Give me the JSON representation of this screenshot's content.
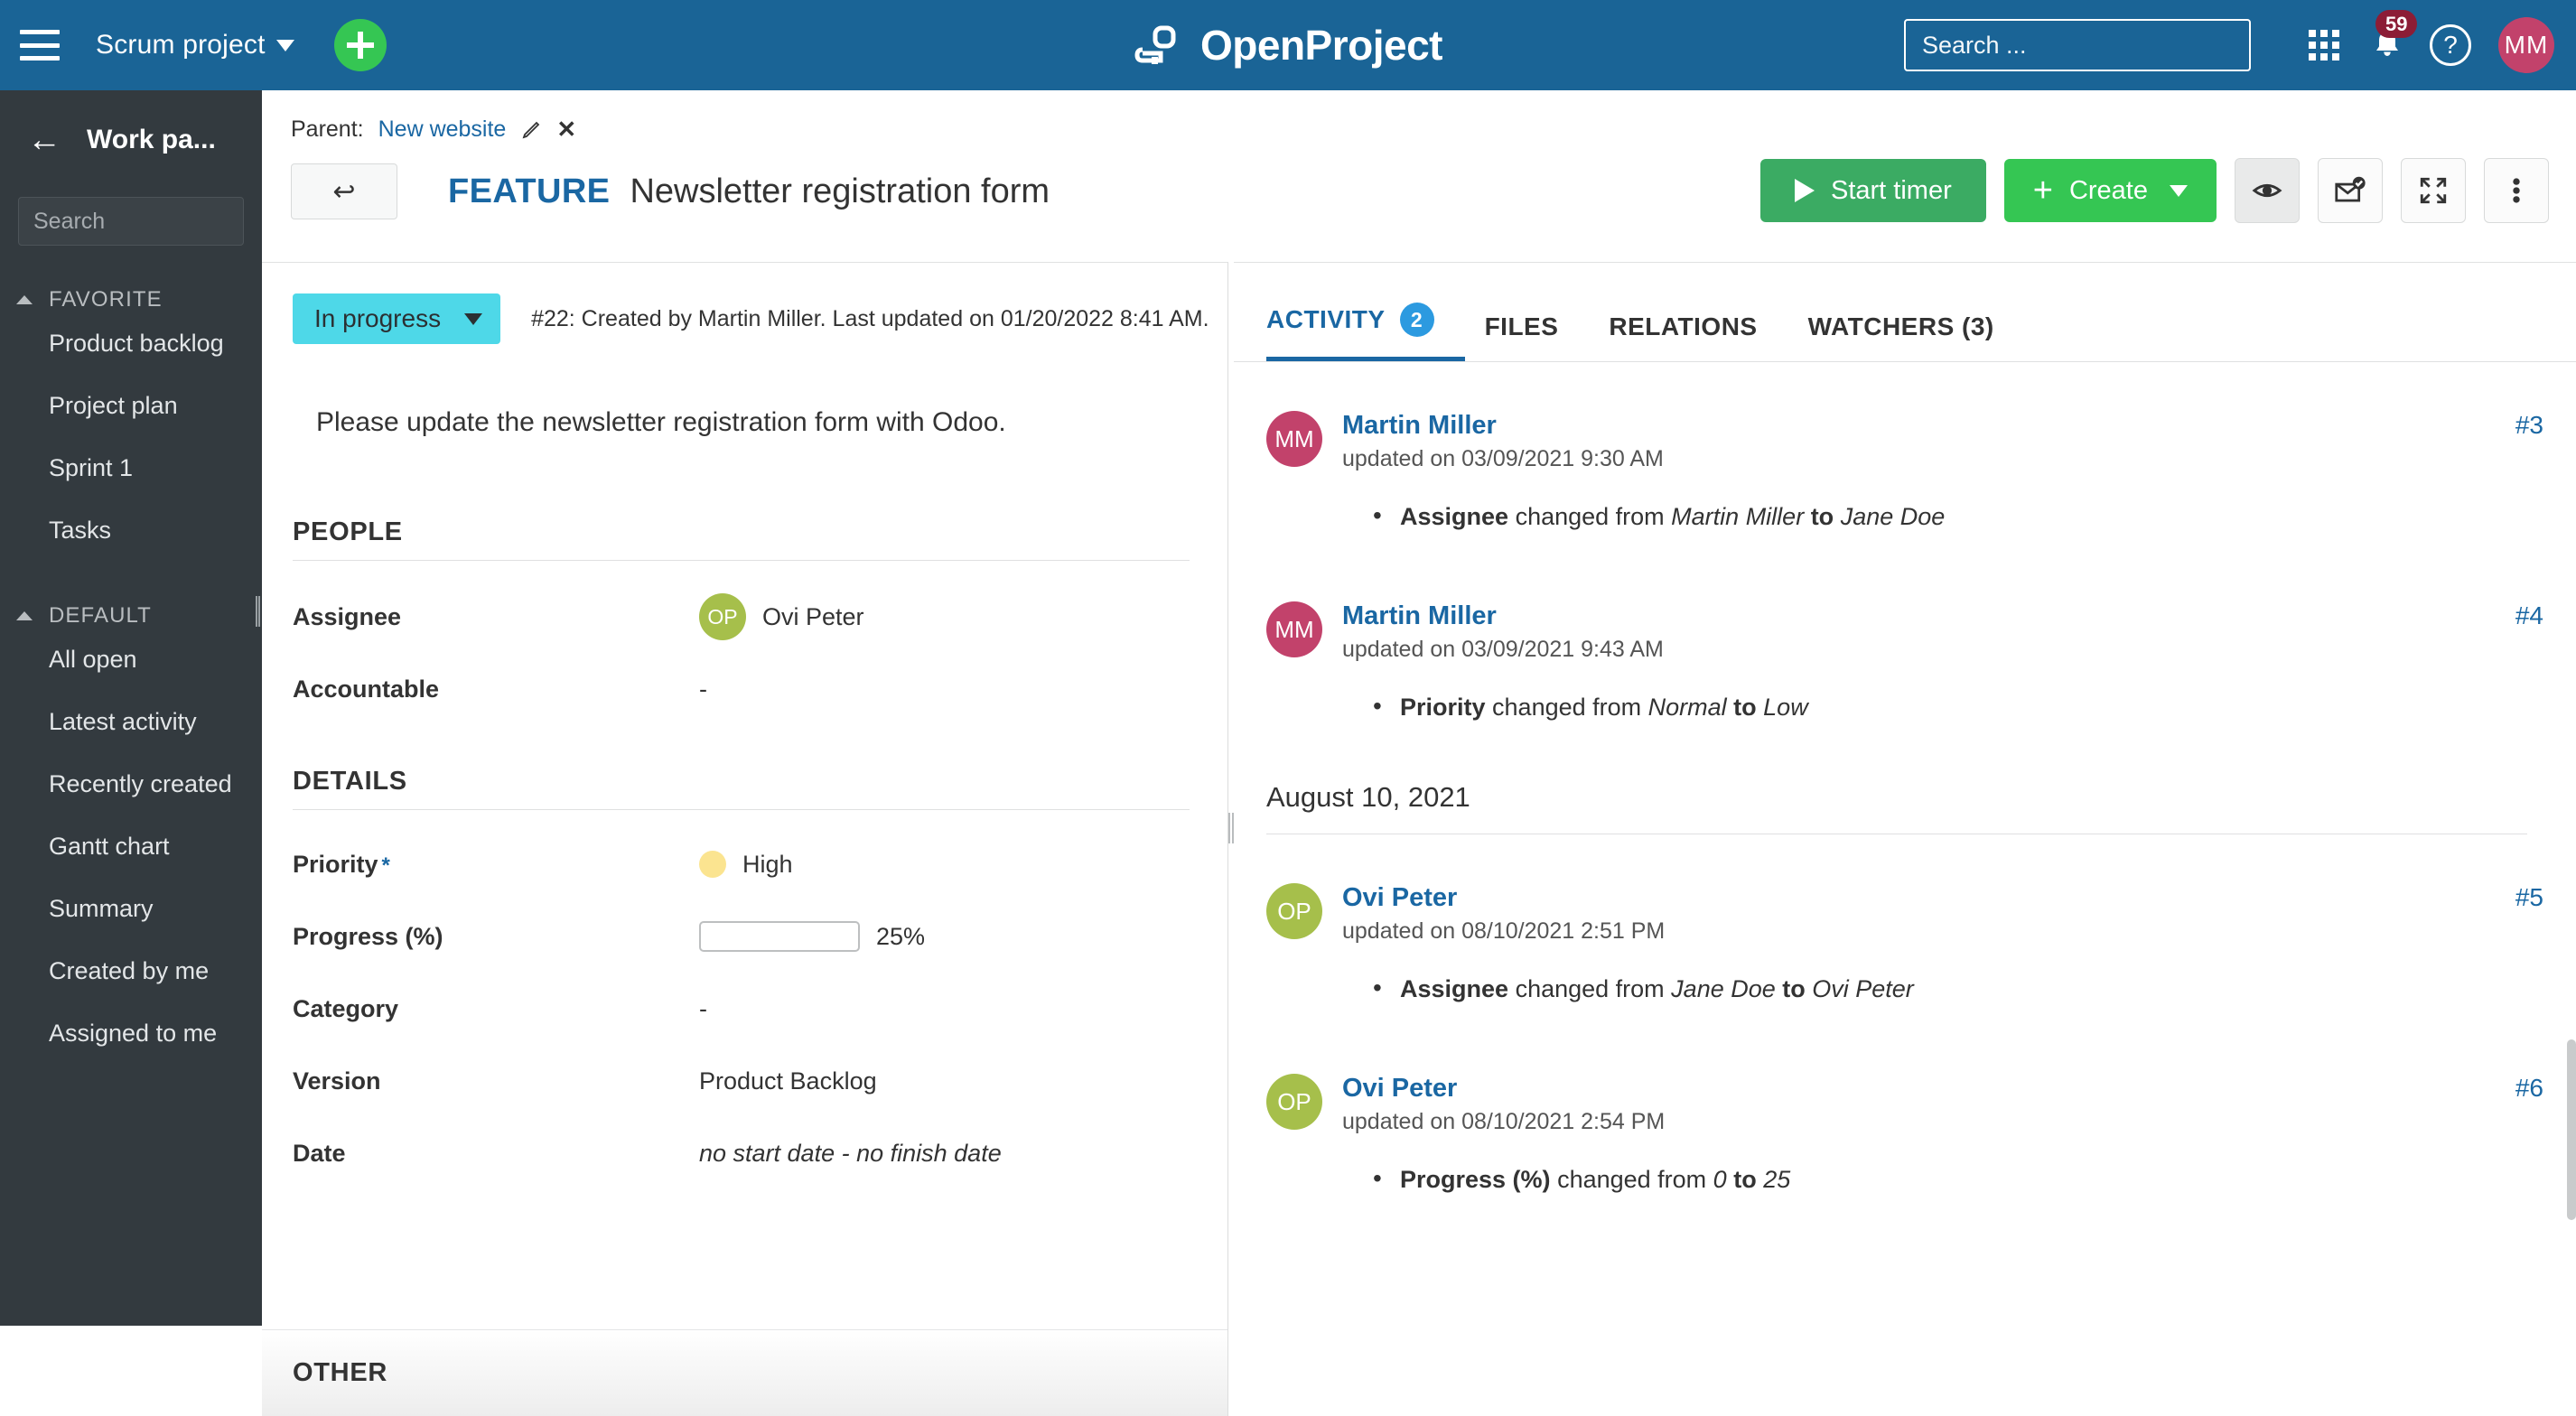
{
  "header": {
    "menu_icon": "hamburger-icon",
    "project_name": "Scrum project",
    "add_label": "+",
    "brand": "OpenProject",
    "search_placeholder": "Search ...",
    "search_value": "",
    "modules_icon": "grid-icon",
    "notification_count": "59",
    "help_label": "?",
    "avatar_initials": "MM"
  },
  "sidebar": {
    "title": "Work pa...",
    "back_icon": "arrow-left-icon",
    "search_placeholder": "Search",
    "search_value": "",
    "groups": [
      {
        "label": "FAVORITE",
        "items": [
          "Product backlog",
          "Project plan",
          "Sprint 1",
          "Tasks"
        ]
      },
      {
        "label": "DEFAULT",
        "items": [
          "All open",
          "Latest activity",
          "Recently created",
          "Gantt chart",
          "Summary",
          "Created by me",
          "Assigned to me"
        ]
      }
    ]
  },
  "work_package": {
    "parent_prefix": "Parent:",
    "parent_name": "New website",
    "back_icon": "back-arrow-icon",
    "type": "FEATURE",
    "subject": "Newsletter registration form",
    "status": "In progress",
    "status_color": "#4ed8e8",
    "meta": "#22: Created by Martin Miller. Last updated on 01/20/2022 8:41 AM.",
    "description": "Please update the newsletter registration form with Odoo."
  },
  "toolbar": {
    "start_timer_label": "Start timer",
    "create_label": "Create",
    "watch_icon": "eye-icon",
    "notification_icon": "mark-read-icon",
    "fullscreen_icon": "fullscreen-icon",
    "more_icon": "more-vertical-icon"
  },
  "sections": [
    {
      "title": "PEOPLE",
      "fields": [
        {
          "label": "Assignee",
          "value": "Ovi Peter",
          "avatar": "OP",
          "avatar_color": "#a6bf4b",
          "type": "user"
        },
        {
          "label": "Accountable",
          "value": "-",
          "type": "text"
        }
      ]
    },
    {
      "title": "DETAILS",
      "fields": [
        {
          "label": "Priority",
          "required": true,
          "value": "High",
          "type": "priority",
          "dot_color": "#fbe490"
        },
        {
          "label": "Progress (%)",
          "value": "25%",
          "percent": 25,
          "type": "progress"
        },
        {
          "label": "Category",
          "value": "-",
          "type": "text"
        },
        {
          "label": "Version",
          "value": "Product Backlog",
          "type": "text"
        },
        {
          "label": "Date",
          "value": "no start date - no finish date",
          "type": "italic"
        }
      ]
    }
  ],
  "other_section_title": "OTHER",
  "activity": {
    "tabs": [
      {
        "label": "ACTIVITY",
        "badge": "2",
        "active": true
      },
      {
        "label": "FILES",
        "active": false
      },
      {
        "label": "RELATIONS",
        "active": false
      },
      {
        "label": "WATCHERS (3)",
        "active": false
      }
    ],
    "entries": [
      {
        "user": "Martin Miller",
        "initials": "MM",
        "avatar_color": "#c2426b",
        "time": "updated on 03/09/2021 9:30 AM",
        "number": "#3",
        "changes": [
          {
            "field": "Assignee",
            "text": " changed from ",
            "from": "Martin Miller",
            "mid": " to ",
            "to": "Jane Doe"
          }
        ]
      },
      {
        "user": "Martin Miller",
        "initials": "MM",
        "avatar_color": "#c2426b",
        "time": "updated on 03/09/2021 9:43 AM",
        "number": "#4",
        "changes": [
          {
            "field": "Priority",
            "text": " changed from ",
            "from": "Normal",
            "mid": " to ",
            "to": "Low"
          }
        ]
      }
    ],
    "date_separator": "August 10, 2021",
    "entries_after": [
      {
        "user": "Ovi Peter",
        "initials": "OP",
        "avatar_color": "#a6bf4b",
        "time": "updated on 08/10/2021 2:51 PM",
        "number": "#5",
        "changes": [
          {
            "field": "Assignee",
            "text": " changed from ",
            "from": "Jane Doe",
            "mid": " to ",
            "to": "Ovi Peter"
          }
        ]
      },
      {
        "user": "Ovi Peter",
        "initials": "OP",
        "avatar_color": "#a6bf4b",
        "time": "updated on 08/10/2021 2:54 PM",
        "number": "#6",
        "changes": [
          {
            "field": "Progress (%)",
            "text": " changed from ",
            "from": "0",
            "mid": " to ",
            "to": "25"
          }
        ]
      }
    ]
  }
}
